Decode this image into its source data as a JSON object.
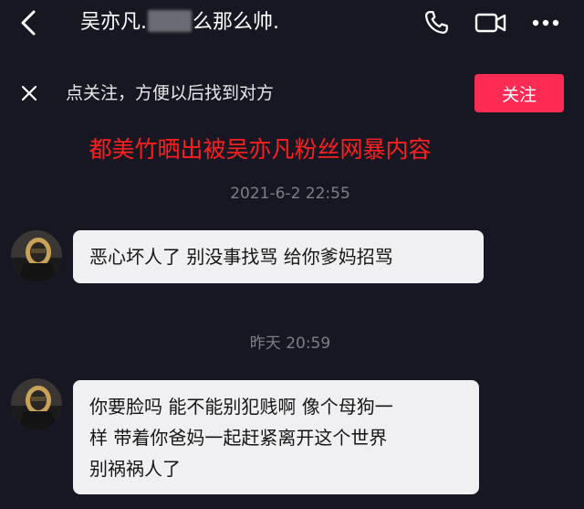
{
  "header": {
    "back_icon": "chevron-left-icon",
    "title_prefix": "吴亦凡.",
    "title_suffix": "么那么帅.",
    "actions": {
      "phone_icon": "phone-icon",
      "video_icon": "video-camera-icon",
      "more_icon": "more-horizontal-icon"
    }
  },
  "follow_bar": {
    "close_icon": "close-icon",
    "text": "点关注，方便以后找到对方",
    "button_label": "关注",
    "button_color": "#fe2c55"
  },
  "headline": {
    "text": "都美竹晒出被吴亦凡粉丝网暴内容",
    "color": "#ff1f1f"
  },
  "messages": [
    {
      "timestamp": "2021-6-2 22:55",
      "text": "恶心坏人了 别没事找骂 给你爹妈招骂"
    },
    {
      "timestamp": "昨天 20:59",
      "lines": [
        "你要脸吗 能不能别犯贱啊 像个母狗一",
        "样 带着你爸妈一起赶紧离开这个世界",
        "别祸祸人了"
      ]
    }
  ]
}
